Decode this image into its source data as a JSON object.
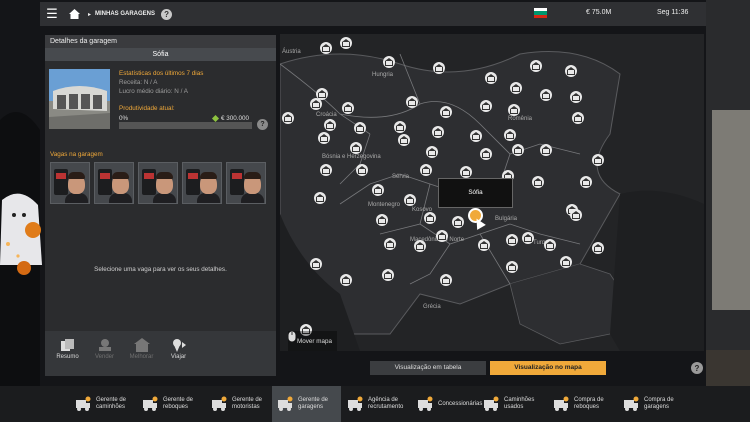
{
  "topbar": {
    "breadcrumb": "MINHAS GARAGENS",
    "help": "?",
    "money": "€ 75.0M",
    "time": "Seg 11:36",
    "flag_colors": [
      "#ffffff",
      "#00966e",
      "#d62612"
    ]
  },
  "garage": {
    "panel_title": "Detalhes da garagem",
    "city": "Sófia",
    "stats_title": "Estatísticas dos últimos 7 dias",
    "receita": "Receita: N / A",
    "lucro": "Lucro médio diário: N / A",
    "prod_title": "Produtividade atual:",
    "prod_percent": "0%",
    "prod_value": 0,
    "upgrade_cost": "€ 300.000",
    "help": "?",
    "slots_title": "Vagas na garagem",
    "slots_count": 5,
    "hint": "Selecione uma vaga para ver os seus detalhes."
  },
  "actions": [
    {
      "label": "Resumo",
      "icon": "summary-icon",
      "enabled": true
    },
    {
      "label": "Vender",
      "icon": "sell-icon",
      "enabled": false
    },
    {
      "label": "Melhorar",
      "icon": "upgrade-icon",
      "enabled": false
    },
    {
      "label": "Viajar",
      "icon": "travel-icon",
      "enabled": true
    }
  ],
  "map": {
    "labels": [
      "Áustria",
      "Hungria",
      "Croácia",
      "Romênia",
      "Bósnia e Herzegovina",
      "Sérvia",
      "Montenegro",
      "Kosovo",
      "Bulgária",
      "Macedônia do Norte",
      "Turquia",
      "Grécia"
    ],
    "tooltip": "Sófia",
    "mover": "Mover mapa"
  },
  "view": {
    "table": "Visualização em tabela",
    "map": "Visualização no mapa",
    "help": "?"
  },
  "bottom_nav": [
    {
      "label": "Gerente de caminhões",
      "icon": "truck-manager-icon",
      "active": false
    },
    {
      "label": "Gerente de reboques",
      "icon": "trailer-manager-icon",
      "active": false
    },
    {
      "label": "Gerente de motoristas",
      "icon": "driver-manager-icon",
      "active": false
    },
    {
      "label": "Gerente de garagens",
      "icon": "garage-manager-icon",
      "active": true
    },
    {
      "label": "Agência de recrutamento",
      "icon": "recruitment-icon",
      "active": false
    },
    {
      "label": "Concessionárias",
      "icon": "dealer-icon",
      "active": false
    },
    {
      "label": "Caminhões usados",
      "icon": "used-trucks-icon",
      "active": false
    },
    {
      "label": "Compra de reboques",
      "icon": "buy-trailers-icon",
      "active": false
    },
    {
      "label": "Compra de garagens",
      "icon": "buy-garages-icon",
      "active": false
    }
  ]
}
